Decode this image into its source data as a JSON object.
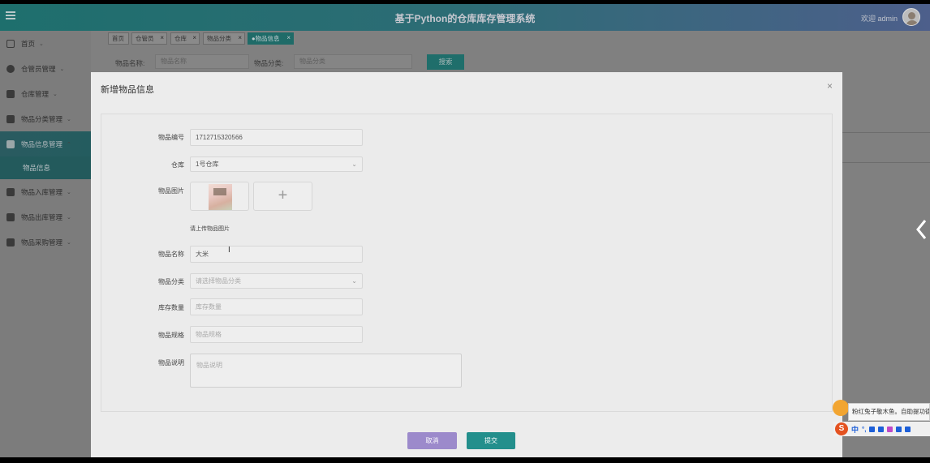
{
  "header": {
    "title": "基于Python的仓库库存管理系统",
    "welcome": "欢迎 admin"
  },
  "sidebar": {
    "items": [
      {
        "label": "首页"
      },
      {
        "label": "仓管员管理"
      },
      {
        "label": "仓库管理"
      },
      {
        "label": "物品分类管理"
      },
      {
        "label": "物品信息管理"
      },
      {
        "label": "物品入库管理"
      },
      {
        "label": "物品出库管理"
      },
      {
        "label": "物品采购管理"
      }
    ],
    "sub_item": "物品信息"
  },
  "tabs": [
    {
      "label": "首页"
    },
    {
      "label": "仓管员"
    },
    {
      "label": "仓库"
    },
    {
      "label": "物品分类"
    },
    {
      "label": "●物品信息"
    }
  ],
  "search": {
    "name_label": "物品名称:",
    "name_placeholder": "物品名称",
    "category_label": "物品分类:",
    "category_placeholder": "物品分类",
    "search_button": "搜索"
  },
  "dialog": {
    "title": "新增物品信息",
    "close": "×",
    "fields": {
      "code_label": "物品编号",
      "code_value": "1712715320566",
      "warehouse_label": "仓库",
      "warehouse_value": "1号仓库",
      "image_label": "物品图片",
      "upload_plus": "+",
      "upload_tip": "请上传物品图片",
      "name_label": "物品名称",
      "name_value": "大米",
      "category_label": "物品分类",
      "category_placeholder": "请选择物品分类",
      "stock_label": "库存数量",
      "stock_placeholder": "库存数量",
      "spec_label": "物品规格",
      "spec_placeholder": "物品规格",
      "desc_label": "物品说明",
      "desc_placeholder": "物品说明"
    },
    "cancel_button": "取消",
    "submit_button": "提交"
  },
  "ime": {
    "tip": "粉红兔子敬木鱼。自助提功德",
    "mode": "中",
    "punct": "°,",
    "logo": "S"
  }
}
